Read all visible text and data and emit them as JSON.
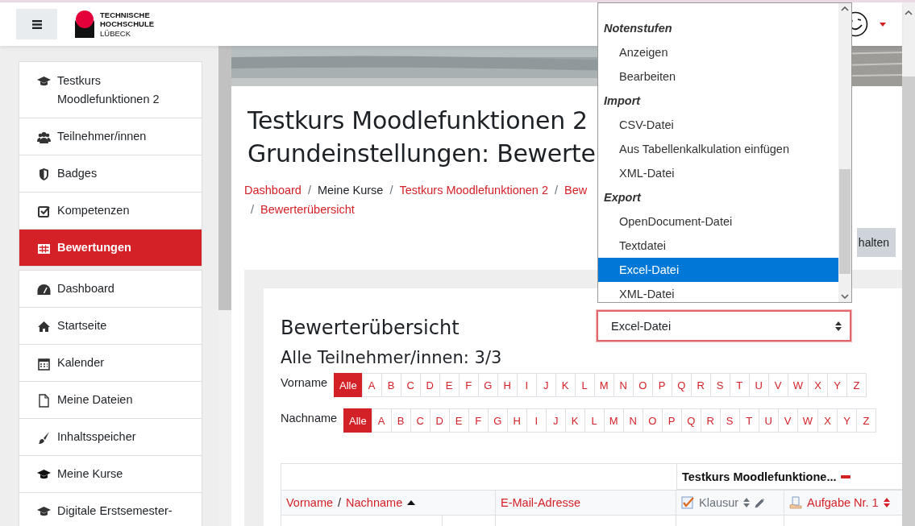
{
  "navbar": {
    "logo_lines": [
      "TECHNISCHE",
      "HOCHSCHULE",
      "LÜBECK"
    ]
  },
  "sidebar": {
    "groups": [
      {
        "items": [
          {
            "label": "Testkurs Moodlefunktionen 2",
            "selected": false
          },
          {
            "label": "Teilnehmer/innen",
            "selected": false
          },
          {
            "label": "Badges",
            "selected": false
          },
          {
            "label": "Kompetenzen",
            "selected": false
          },
          {
            "label": "Bewertungen",
            "selected": true
          }
        ]
      },
      {
        "items": [
          {
            "label": "Dashboard",
            "selected": false
          },
          {
            "label": "Startseite",
            "selected": false
          },
          {
            "label": "Kalender",
            "selected": false
          },
          {
            "label": "Meine Dateien",
            "selected": false
          },
          {
            "label": "Inhaltsspeicher",
            "selected": false
          },
          {
            "label": "Meine Kurse",
            "selected": false
          },
          {
            "label": "Digitale Erstsemester-",
            "selected": false
          }
        ]
      }
    ]
  },
  "page_title": [
    "Testkurs Moodlefunktionen 2",
    "Grundeinstellungen: Bewerte"
  ],
  "breadcrumb": {
    "separator": "/",
    "items": [
      {
        "label": "Dashboard",
        "link": true
      },
      {
        "label": "Meine Kurse",
        "link": false
      },
      {
        "label": "Testkurs Moodlefunktionen 2",
        "link": true
      },
      {
        "label": "Bew",
        "link": true
      },
      {
        "label": "Bewerterübersicht",
        "link": true
      }
    ]
  },
  "view_button": {
    "label": "halten"
  },
  "report": {
    "heading": "Bewerterübersicht",
    "select": {
      "value": "Excel-Datei",
      "focused": true
    },
    "participants": "Alle Teilnehmer/innen: 3/3",
    "filters": [
      {
        "label": "Vorname",
        "options": [
          {
            "label": "Alle",
            "selected": true
          },
          {
            "label": "A",
            "selected": false
          },
          {
            "label": "B",
            "selected": false
          },
          {
            "label": "C",
            "selected": false
          },
          {
            "label": "D",
            "selected": false
          },
          {
            "label": "E",
            "selected": false
          },
          {
            "label": "F",
            "selected": false
          },
          {
            "label": "G",
            "selected": false
          },
          {
            "label": "H",
            "selected": false
          },
          {
            "label": "I",
            "selected": false
          },
          {
            "label": "J",
            "selected": false
          },
          {
            "label": "K",
            "selected": false
          },
          {
            "label": "L",
            "selected": false
          },
          {
            "label": "M",
            "selected": false
          },
          {
            "label": "N",
            "selected": false
          },
          {
            "label": "O",
            "selected": false
          },
          {
            "label": "P",
            "selected": false
          },
          {
            "label": "Q",
            "selected": false
          },
          {
            "label": "R",
            "selected": false
          },
          {
            "label": "S",
            "selected": false
          },
          {
            "label": "T",
            "selected": false
          },
          {
            "label": "U",
            "selected": false
          },
          {
            "label": "V",
            "selected": false
          },
          {
            "label": "W",
            "selected": false
          },
          {
            "label": "X",
            "selected": false
          },
          {
            "label": "Y",
            "selected": false
          },
          {
            "label": "Z",
            "selected": false
          }
        ]
      },
      {
        "label": "Nachname",
        "options": [
          {
            "label": "Alle",
            "selected": true
          },
          {
            "label": "A",
            "selected": false
          },
          {
            "label": "B",
            "selected": false
          },
          {
            "label": "C",
            "selected": false
          },
          {
            "label": "D",
            "selected": false
          },
          {
            "label": "E",
            "selected": false
          },
          {
            "label": "F",
            "selected": false
          },
          {
            "label": "G",
            "selected": false
          },
          {
            "label": "H",
            "selected": false
          },
          {
            "label": "I",
            "selected": false
          },
          {
            "label": "J",
            "selected": false
          },
          {
            "label": "K",
            "selected": false
          },
          {
            "label": "L",
            "selected": false
          },
          {
            "label": "M",
            "selected": false
          },
          {
            "label": "N",
            "selected": false
          },
          {
            "label": "O",
            "selected": false
          },
          {
            "label": "P",
            "selected": false
          },
          {
            "label": "Q",
            "selected": false
          },
          {
            "label": "R",
            "selected": false
          },
          {
            "label": "S",
            "selected": false
          },
          {
            "label": "T",
            "selected": false
          },
          {
            "label": "U",
            "selected": false
          },
          {
            "label": "V",
            "selected": false
          },
          {
            "label": "W",
            "selected": false
          },
          {
            "label": "X",
            "selected": false
          },
          {
            "label": "Y",
            "selected": false
          },
          {
            "label": "Z",
            "selected": false
          }
        ]
      }
    ],
    "table": {
      "group_header": "Testkurs Moodlefunktione...",
      "name_column": {
        "first": "Vorname",
        "separator": "/",
        "last": "Nachname"
      },
      "columns": [
        {
          "label": "E-Mail-Adresse",
          "link": true,
          "kind": "email"
        },
        {
          "label": "Klausur",
          "link": false,
          "kind": "quiz"
        },
        {
          "label": "Aufgabe Nr. 1",
          "link": true,
          "kind": "assignment"
        }
      ]
    }
  },
  "dropdown": {
    "groups": [
      {
        "label": "Notenstufen",
        "options": [
          {
            "label": "Anzeigen",
            "selected": false
          },
          {
            "label": "Bearbeiten",
            "selected": false
          }
        ]
      },
      {
        "label": "Import",
        "options": [
          {
            "label": "CSV-Datei",
            "selected": false
          },
          {
            "label": "Aus Tabellenkalkulation einfügen",
            "selected": false
          },
          {
            "label": "XML-Datei",
            "selected": false
          }
        ]
      },
      {
        "label": "Export",
        "options": [
          {
            "label": "OpenDocument-Datei",
            "selected": false
          },
          {
            "label": "Textdatei",
            "selected": false
          },
          {
            "label": "Excel-Datei",
            "selected": true
          },
          {
            "label": "XML-Datei",
            "selected": false
          }
        ]
      }
    ]
  }
}
